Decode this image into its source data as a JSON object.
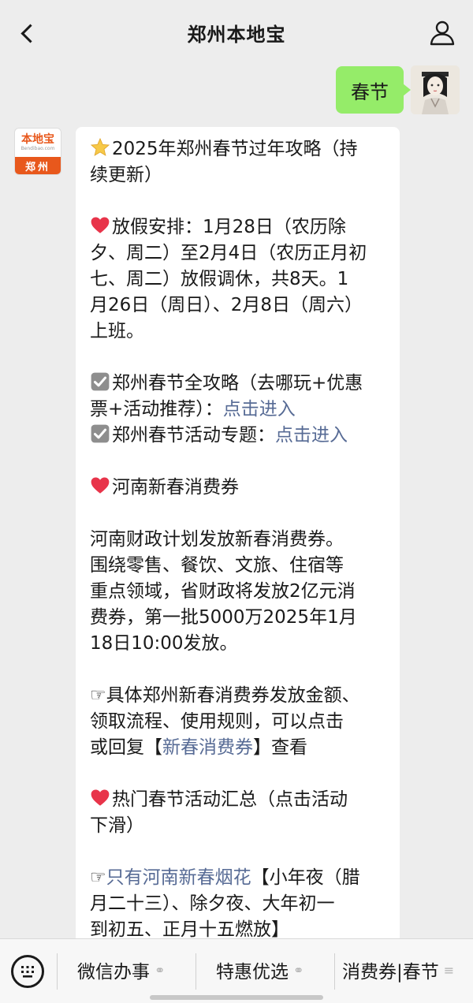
{
  "header": {
    "title": "郑州本地宝",
    "back_icon": "chevron-left-icon",
    "profile_icon": "person-icon"
  },
  "outgoing": {
    "text": "春节"
  },
  "bot": {
    "avatar_brand": "本地宝",
    "avatar_sub": "Bendibao.com",
    "avatar_city": "郑州"
  },
  "message": {
    "heading_line1": "2025年郑州春节过年攻略（持",
    "heading_line2": "续更新）",
    "holiday_lines": [
      "放假安排：1月28日（农历除",
      "夕、周二）至2月4日（农历正月初",
      "七、周二）放假调休，共8天。1",
      "月26日（周日）、2月8日（周六）",
      "上班。"
    ],
    "guide1_line1": "郑州春节全攻略（去哪玩+优惠",
    "guide1_line2_prefix": "票+活动推荐）：",
    "guide1_link": "点击进入",
    "guide2_prefix": "郑州春节活动专题：",
    "guide2_link": "点击进入",
    "voucher_heading": "河南新春消费券",
    "voucher_lines": [
      "河南财政计划发放新春消费券。",
      "围绕零售、餐饮、文旅、住宿等",
      "重点领域，省财政将发放2亿元消",
      "费券，第一批5000万2025年1月",
      "18日10:00发放。"
    ],
    "detail_line1": "具体郑州新春消费券发放金额、",
    "detail_line2": "领取流程、使用规则，可以点击",
    "detail_line3_prefix": "或回复【",
    "detail_link": "新春消费券",
    "detail_line3_suffix": "】查看",
    "events_line1": "热门春节活动汇总（点击活动",
    "events_line2": "下滑）",
    "fireworks_link": "只有河南新春烟花",
    "fireworks_line1_suffix": "【小年夜（腊",
    "fireworks_line2": "月二十三）、除夕夜、大年初一",
    "fireworks_line3": "到初五、正月十五燃放】"
  },
  "menu": {
    "items": [
      {
        "label": "微信办事",
        "icon": "link-icon"
      },
      {
        "label": "特惠优选",
        "icon": "link-icon"
      },
      {
        "label": "消费券|春节",
        "icon": "list-icon"
      }
    ]
  }
}
